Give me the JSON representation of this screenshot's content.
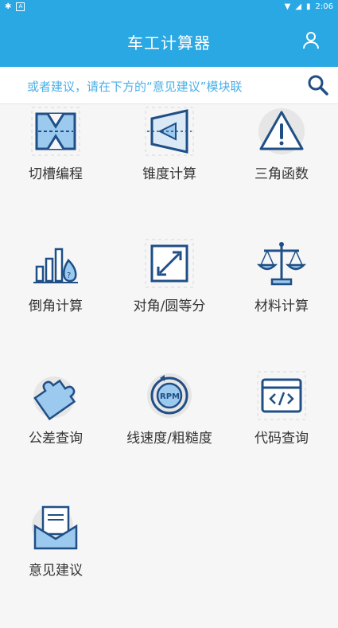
{
  "status_bar": {
    "time": "2:06"
  },
  "app_bar": {
    "title": "车工计算器"
  },
  "marquee": {
    "text": "或者建议，请在下方的“意见建议”模块联"
  },
  "tiles": [
    {
      "label": "切槽编程",
      "icon": "grooving-icon"
    },
    {
      "label": "锥度计算",
      "icon": "taper-icon"
    },
    {
      "label": "三角函数",
      "icon": "warning-triangle-icon"
    },
    {
      "label": "倒角计算",
      "icon": "chamfer-chart-icon"
    },
    {
      "label": "对角/圆等分",
      "icon": "diagonal-arrow-icon"
    },
    {
      "label": "材料计算",
      "icon": "scale-icon"
    },
    {
      "label": "公差查询",
      "icon": "puzzle-icon"
    },
    {
      "label": "线速度/粗糙度",
      "icon": "rpm-icon"
    },
    {
      "label": "代码查询",
      "icon": "code-window-icon"
    },
    {
      "label": "意见建议",
      "icon": "mail-letter-icon"
    }
  ],
  "colors": {
    "accent": "#2aa8e4",
    "icon_blue": "#3a7cc4",
    "icon_fill": "#9cc9ee"
  }
}
